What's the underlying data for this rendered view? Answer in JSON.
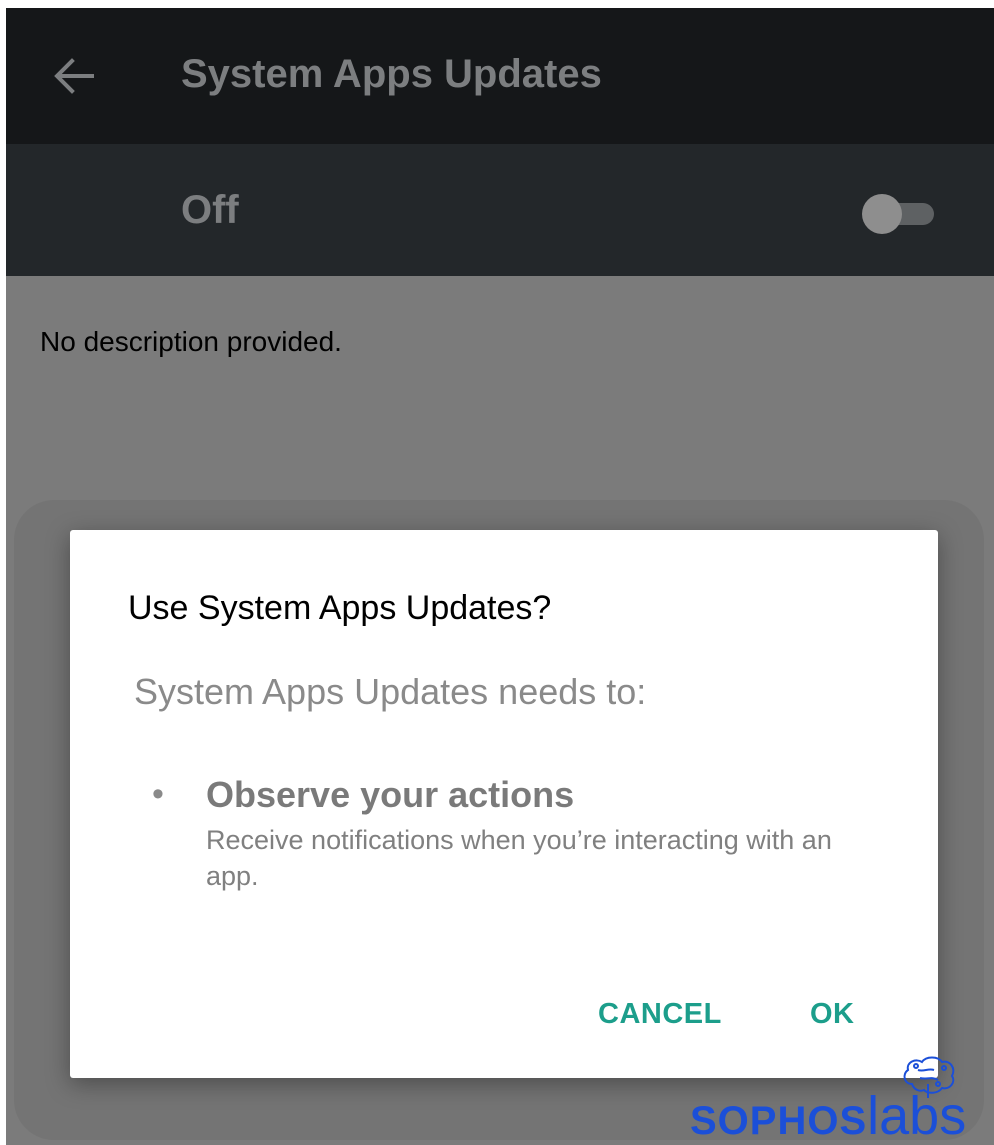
{
  "toolbar": {
    "back_icon": "arrow-left-icon",
    "title": "System Apps Updates"
  },
  "switch_bar": {
    "label": "Off",
    "toggle_on": false
  },
  "description": "No description provided.",
  "dialog": {
    "title": "Use System Apps Updates?",
    "subtitle": "System Apps Updates needs to:",
    "permissions": [
      {
        "bullet": "•",
        "title": "Observe your actions",
        "description": "Receive notifications when you’re interacting with an app."
      }
    ],
    "cancel_label": "CANCEL",
    "ok_label": "OK"
  },
  "watermark": {
    "brand": "SOPHOS",
    "suffix": "labs"
  },
  "colors": {
    "accent": "#1c9e8b",
    "toolbar": "#151719",
    "switch_bar": "#23272a",
    "scrim": "#7b7b7b",
    "watermark": "#1b4fd8"
  }
}
